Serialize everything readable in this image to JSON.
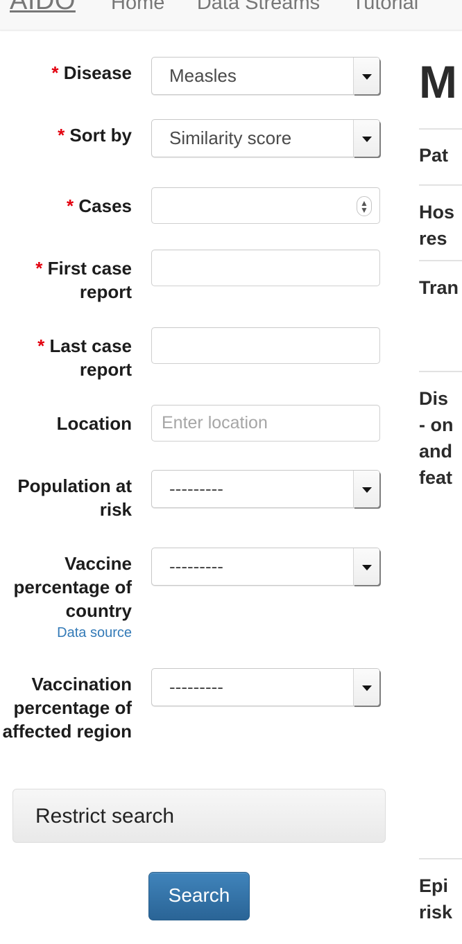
{
  "navbar": {
    "brand": "AIDO",
    "links": [
      {
        "label": "Home"
      },
      {
        "label": "Data Streams"
      },
      {
        "label": "Tutorial"
      }
    ]
  },
  "form": {
    "fields": [
      {
        "name": "disease",
        "label": "Disease",
        "required": true,
        "type": "select",
        "value": "Measles"
      },
      {
        "name": "sort-by",
        "label": "Sort by",
        "required": true,
        "type": "select",
        "value": "Similarity score"
      },
      {
        "name": "cases",
        "label": "Cases",
        "required": true,
        "type": "number",
        "value": "",
        "placeholder": ""
      },
      {
        "name": "first-case-report",
        "label": "First case report",
        "required": true,
        "type": "text",
        "value": "",
        "placeholder": ""
      },
      {
        "name": "last-case-report",
        "label": "Last case report",
        "required": true,
        "type": "text",
        "value": "",
        "placeholder": ""
      },
      {
        "name": "location",
        "label": "Location",
        "required": false,
        "type": "text",
        "value": "",
        "placeholder": "Enter location"
      },
      {
        "name": "population-at-risk",
        "label": "Population at risk",
        "required": false,
        "type": "select",
        "value": "---------"
      },
      {
        "name": "vaccine-percentage-of-country",
        "label": "Vaccine percentage of country",
        "sublink": "Data source",
        "required": false,
        "type": "select",
        "value": "---------"
      },
      {
        "name": "vaccination-percentage-of-affected-region",
        "label": "Vaccination percentage of affected region",
        "required": false,
        "type": "select",
        "value": "---------"
      }
    ],
    "restrict_search_label": "Restrict search",
    "search_button_label": "Search"
  },
  "results": {
    "title": "M",
    "items": [
      {
        "text": "Pat"
      },
      {
        "text": "Hos\nres"
      },
      {
        "text": "Tran"
      },
      {
        "text": "Dis\n- on\nand\nfeat"
      },
      {
        "text": "Epi\nrisk"
      }
    ]
  },
  "colors": {
    "required_asterisk": "#e3000f",
    "link": "#337ab7",
    "primary_button": "#2a6496",
    "navbar_bg": "#f8f8f8"
  }
}
